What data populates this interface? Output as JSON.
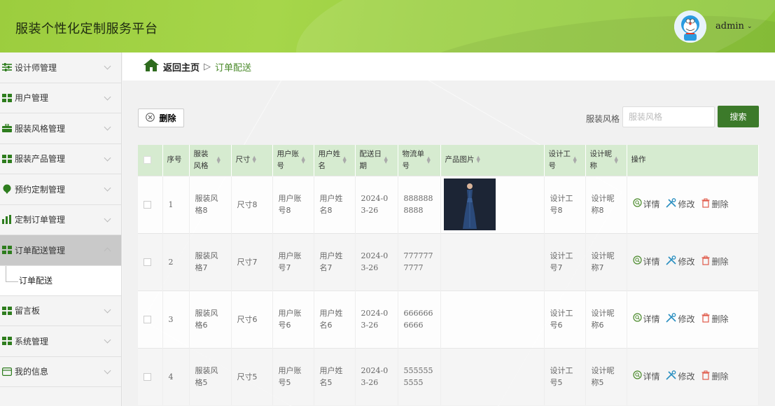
{
  "app": {
    "title": "服装个性化定制服务平台",
    "user": "admin"
  },
  "sidebar": {
    "items": [
      {
        "label": "设计师管理"
      },
      {
        "label": "用户管理"
      },
      {
        "label": "服装风格管理"
      },
      {
        "label": "服装产品管理"
      },
      {
        "label": "预约定制管理"
      },
      {
        "label": "定制订单管理"
      },
      {
        "label": "订单配送管理"
      },
      {
        "label": "留言板"
      },
      {
        "label": "系统管理"
      },
      {
        "label": "我的信息"
      }
    ],
    "submenu": "订单配送"
  },
  "breadcrumb": {
    "home": "返回主页",
    "sep": "▷",
    "current": "订单配送"
  },
  "toolbar": {
    "delete_label": "删除",
    "search_label": "服装风格",
    "search_placeholder": "服装风格",
    "search_button": "搜索"
  },
  "table": {
    "headers": [
      "序号",
      "服装风格",
      "尺寸",
      "用户账号",
      "用户姓名",
      "配送日期",
      "物流单号",
      "产品图片",
      "设计工号",
      "设计昵称",
      "操作"
    ],
    "rows": [
      {
        "no": "1",
        "style": "服装风格8",
        "size": "尺寸8",
        "account": "用户账号8",
        "name": "用户姓名8",
        "date": "2024-03-26",
        "tracking": "8888888888",
        "designer_no": "设计工号8",
        "designer_name": "设计昵称8"
      },
      {
        "no": "2",
        "style": "服装风格7",
        "size": "尺寸7",
        "account": "用户账号7",
        "name": "用户姓名7",
        "date": "2024-03-26",
        "tracking": "7777777777",
        "designer_no": "设计工号7",
        "designer_name": "设计昵称7"
      },
      {
        "no": "3",
        "style": "服装风格6",
        "size": "尺寸6",
        "account": "用户账号6",
        "name": "用户姓名6",
        "date": "2024-03-26",
        "tracking": "6666666666",
        "designer_no": "设计工号6",
        "designer_name": "设计昵称6"
      },
      {
        "no": "4",
        "style": "服装风格5",
        "size": "尺寸5",
        "account": "用户账号5",
        "name": "用户姓名5",
        "date": "2024-03-26",
        "tracking": "5555555555",
        "designer_no": "设计工号5",
        "designer_name": "设计昵称5"
      }
    ],
    "actions": {
      "detail": "详情",
      "edit": "修改",
      "delete": "删除"
    }
  },
  "colors": {
    "header_green": "#a6d64a",
    "accent": "#3c7a2a",
    "table_head": "#d6ebd0",
    "delete_red": "#e05a4a"
  }
}
